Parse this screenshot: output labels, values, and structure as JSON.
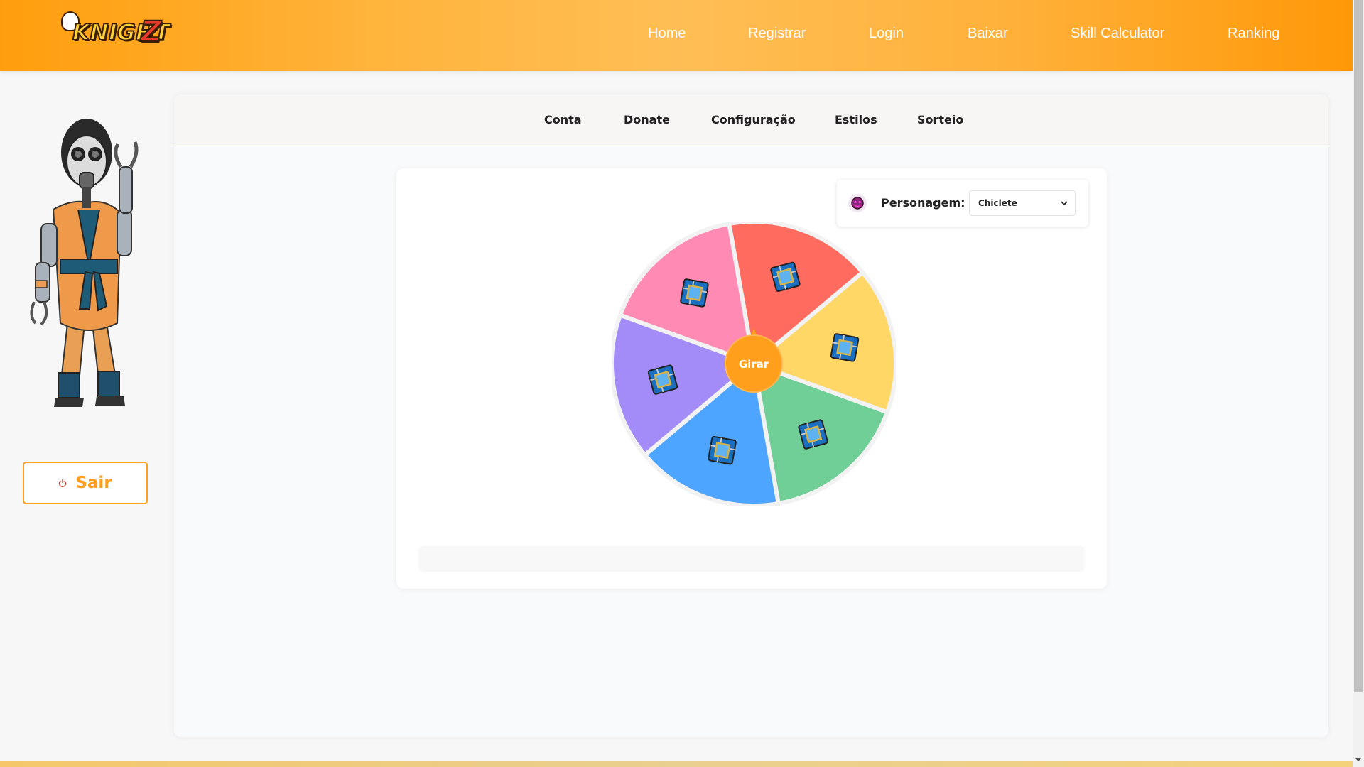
{
  "header": {
    "logo_text": "KNIGHTZ",
    "nav": [
      "Home",
      "Registrar",
      "Login",
      "Baixar",
      "Skill Calculator",
      "Ranking"
    ]
  },
  "sidebar": {
    "logout_label": "Sair"
  },
  "tabs": [
    "Conta",
    "Donate",
    "Configuração",
    "Estilos",
    "Sorteio"
  ],
  "roulette": {
    "character_label": "Personagem:",
    "character_selected": "Chiclete",
    "spin_label": "Girar",
    "segment_colors": [
      "#ff6b5e",
      "#ffd766",
      "#6fcf97",
      "#4ea5ff",
      "#a38cf8",
      "#ff8ab3"
    ],
    "pointer_color": "#ff9f1c",
    "result_text": ""
  },
  "colors": {
    "accent": "#ff9d1c",
    "header_start": "#ff9e0d",
    "header_end": "#ff9808"
  }
}
